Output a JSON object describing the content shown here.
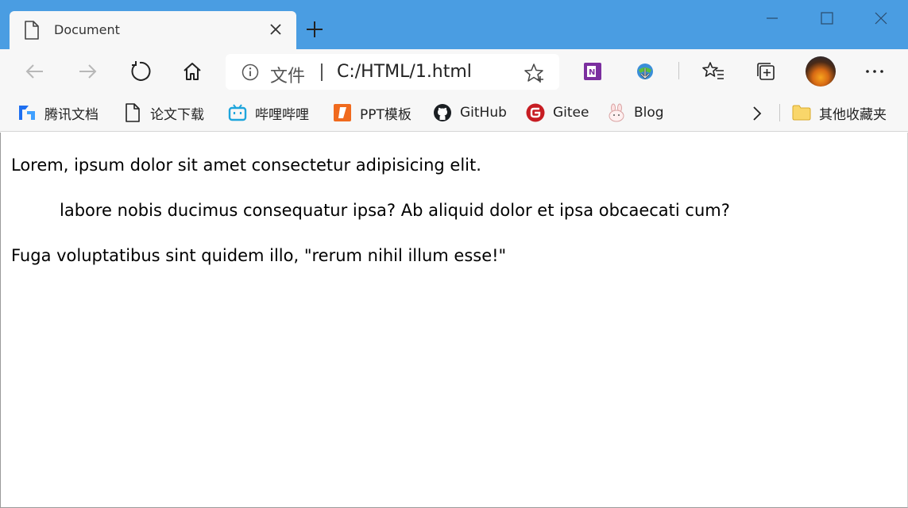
{
  "tab": {
    "title": "Document",
    "close_icon": "close-icon",
    "doc_icon": "document-icon"
  },
  "window": {
    "new_tab_icon": "plus-icon",
    "minimize_icon": "minimize-icon",
    "maximize_icon": "maximize-icon",
    "close_icon": "close-icon"
  },
  "toolbar": {
    "back_icon": "arrow-left-icon",
    "forward_icon": "arrow-right-icon",
    "refresh_icon": "refresh-icon",
    "home_icon": "home-icon",
    "address": {
      "info_label": "文件",
      "url": "C:/HTML/1.html"
    },
    "extensions": [
      "onenote-icon",
      "download-manager-icon"
    ],
    "favorites_icon": "favorites-list-icon",
    "collections_icon": "collections-icon",
    "more_icon": "more-icon"
  },
  "bookmarks": {
    "items": [
      {
        "label": "腾讯文档",
        "icon": "tencent-docs-icon"
      },
      {
        "label": "论文下载",
        "icon": "page-icon"
      },
      {
        "label": "哔哩哔哩",
        "icon": "bilibili-icon"
      },
      {
        "label": "PPT模板",
        "icon": "ppt-icon"
      },
      {
        "label": "GitHub",
        "icon": "github-icon"
      },
      {
        "label": "Gitee",
        "icon": "gitee-icon"
      },
      {
        "label": "Blog",
        "icon": "bunny-icon"
      }
    ],
    "more_icon": "chevron-right-icon",
    "other_folder": {
      "label": "其他收藏夹",
      "icon": "folder-icon"
    }
  },
  "content": {
    "paragraphs": [
      "Lorem, ipsum dolor sit amet consectetur adipisicing elit.",
      "labore nobis ducimus consequatur ipsa? Ab aliquid dolor et ipsa obcaecati cum?",
      "Fuga voluptatibus sint quidem illo, \"rerum nihil illum esse!\""
    ]
  },
  "colors": {
    "titlebar": "#4a9de2",
    "toolbar": "#f7f7f7",
    "content": "#ffffff"
  }
}
